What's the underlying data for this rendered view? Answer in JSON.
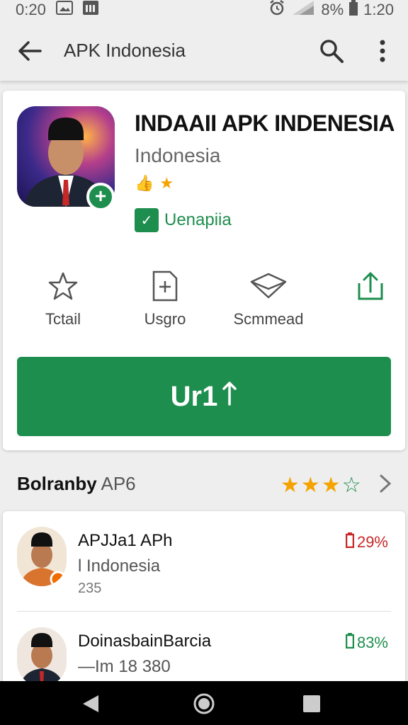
{
  "status_bar": {
    "time_left": "0:20",
    "battery": "8%",
    "time_right": "1:20"
  },
  "app_bar": {
    "title": "APK Indonesia"
  },
  "app": {
    "name": "INDAAII APK INDENESIA",
    "developer": "Indonesia",
    "rating_badge": "👍",
    "star": "★",
    "verified_label": "Uenapiia",
    "verified_icon": "✓"
  },
  "actions": [
    {
      "label": "Tctail",
      "icon": "star-outline-icon"
    },
    {
      "label": "Usgro",
      "icon": "document-icon"
    },
    {
      "label": "Scmmead",
      "icon": "envelope-icon"
    },
    {
      "label": "",
      "icon": "share-icon"
    }
  ],
  "install_button": {
    "label": "Ur1"
  },
  "section": {
    "title_bold": "Bolranby",
    "title_rest": "AP6",
    "stars_filled": "★★★",
    "stars_empty": "☆"
  },
  "list": [
    {
      "name": "APJJa1 APh",
      "sub": "l Indonesia",
      "meta": "235",
      "pct": "29%",
      "pct_color": "#c62828"
    },
    {
      "name": "DoinasbainBarcia",
      "sub": "—Im 18 380",
      "meta": "",
      "pct": "83%",
      "pct_color": "#1e8e4e"
    }
  ],
  "colors": {
    "accent": "#1e8e4e",
    "star": "#f4a300",
    "background": "#eeeeee"
  }
}
